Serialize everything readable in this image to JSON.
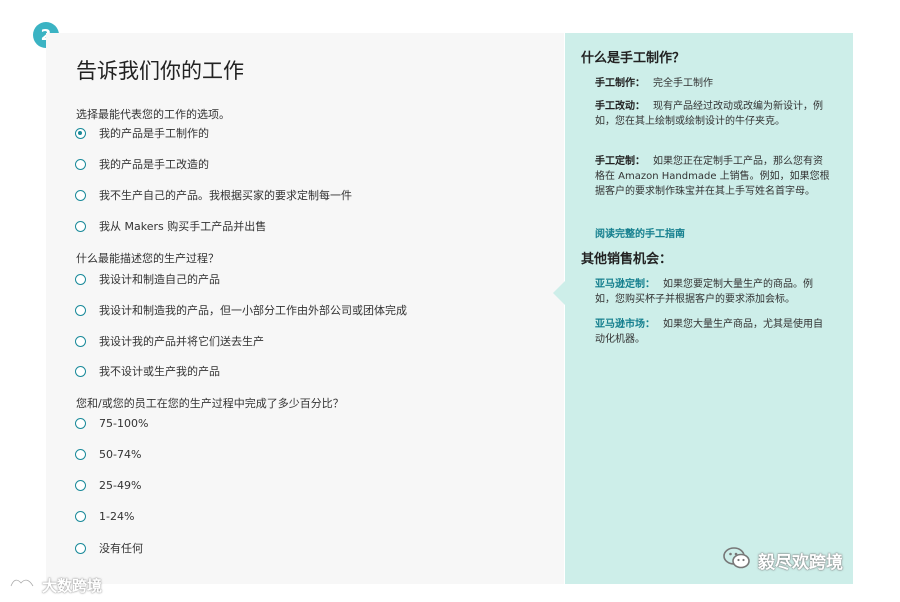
{
  "step_number": "2",
  "page_title": "告诉我们你的工作",
  "questions": [
    {
      "label": "选择最能代表您的工作的选项。",
      "options": [
        {
          "label": "我的产品是手工制作的",
          "checked": true
        },
        {
          "label": "我的产品是手工改造的",
          "checked": false
        },
        {
          "label": "我不生产自己的产品。我根据买家的要求定制每一件",
          "checked": false
        },
        {
          "label": "我从 Makers 购买手工产品并出售",
          "checked": false
        }
      ]
    },
    {
      "label": "什么最能描述您的生产过程？",
      "options": [
        {
          "label": "我设计和制造自己的产品",
          "checked": false
        },
        {
          "label": "我设计和制造我的产品，但一小部分工作由外部公司或团体完成",
          "checked": false
        },
        {
          "label": "我设计我的产品并将它们送去生产",
          "checked": false
        },
        {
          "label": "我不设计或生产我的产品",
          "checked": false
        }
      ]
    },
    {
      "label": "您和/或您的员工在您的生产过程中完成了多少百分比？",
      "options": [
        {
          "label": "75-100%",
          "checked": false
        },
        {
          "label": "50-74%",
          "checked": false
        },
        {
          "label": "25-49%",
          "checked": false
        },
        {
          "label": "1-24%",
          "checked": false
        },
        {
          "label": "没有任何",
          "checked": false
        }
      ]
    }
  ],
  "sidebar": {
    "heading1": "什么是手工制作？",
    "items1": [
      {
        "term": "手工制作：",
        "desc": "完全手工制作"
      },
      {
        "term": "手工改动：",
        "desc": "现有产品经过改动或改编为新设计，例如，您在其上绘制或绘制设计的牛仔夹克。"
      },
      {
        "term": "手工定制：",
        "desc": "如果您正在定制手工产品，那么您有资格在 Amazon Handmade 上销售。例如，如果您根据客户的要求制作珠宝并在其上手写姓名首字母。"
      }
    ],
    "guide_link": "阅读完整的手工指南",
    "heading2": "其他销售机会：",
    "items2": [
      {
        "term": "亚马逊定制：",
        "desc": "如果您要定制大量生产的商品。例如，您购买杯子并根据客户的要求添加会标。"
      },
      {
        "term": "亚马逊市场：",
        "desc": "如果您大量生产商品，尤其是使用自动化机器。"
      }
    ]
  },
  "watermark_left": "大数跨境",
  "watermark_right": "毅尽欢跨境",
  "colors": {
    "accent": "#16808f",
    "side_bg": "#cdeee9",
    "badge": "#3bb3c3"
  }
}
